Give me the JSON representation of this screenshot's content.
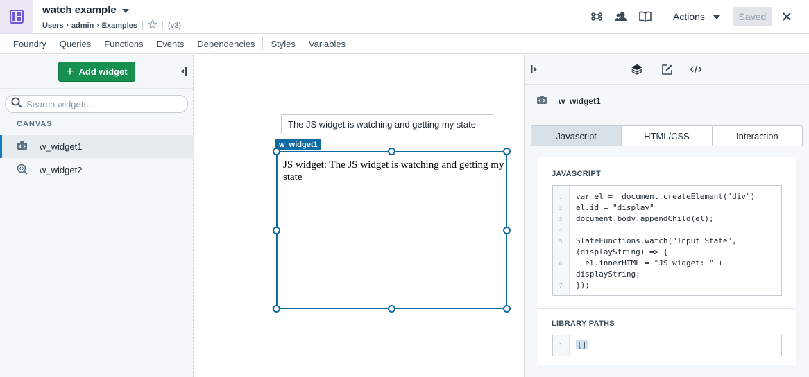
{
  "header": {
    "title": "watch example",
    "breadcrumbs": [
      "Users",
      "admin",
      "Examples"
    ],
    "version": "(v3)",
    "actions_label": "Actions",
    "saved_label": "Saved"
  },
  "menu": {
    "items": [
      "Foundry",
      "Queries",
      "Functions",
      "Events",
      "Dependencies",
      "Styles",
      "Variables"
    ]
  },
  "left": {
    "add_widget_label": "Add widget",
    "search_placeholder": "Search widgets...",
    "canvas_label": "CANVAS",
    "widgets": [
      {
        "name": "w_widget1",
        "selected": true
      },
      {
        "name": "w_widget2",
        "selected": false
      }
    ]
  },
  "canvas": {
    "text_input_value": "The JS widget is watching and getting my state",
    "widget_tag": "w_widget1",
    "widget_output": "JS widget: The JS widget is watching and getting my state"
  },
  "right": {
    "selected_widget": "w_widget1",
    "tabs": [
      {
        "label": "Javascript",
        "active": true
      },
      {
        "label": "HTML/CSS",
        "active": false
      },
      {
        "label": "Interaction",
        "active": false
      }
    ],
    "javascript_label": "JAVASCRIPT",
    "code_lines": [
      {
        "num": "1",
        "text": "var el =  document.createElement(\"div\")"
      },
      {
        "num": "2",
        "text": "el.id = \"display\""
      },
      {
        "num": "3",
        "text": "document.body.appendChild(el);"
      },
      {
        "num": "4",
        "text": ""
      },
      {
        "num": "5",
        "text": "SlateFunctions.watch(\"Input State\","
      },
      {
        "num": "",
        "text": "(displayString) => {"
      },
      {
        "num": "6",
        "text": "  el.innerHTML = \"JS widget: \" +"
      },
      {
        "num": "",
        "text": "displayString;"
      },
      {
        "num": "7",
        "text": "});"
      }
    ],
    "library_paths_label": "LIBRARY PATHS",
    "library_line_num": "1",
    "library_value": "[]"
  },
  "colors": {
    "accent_blue": "#106ba3",
    "add_button_green": "#15904f",
    "app_icon_bg": "#ece6f5",
    "app_icon_fg": "#7157d9"
  },
  "icons": {
    "app": "app-layout-icon",
    "command": "command-icon",
    "users": "users-icon",
    "docs": "book-icon",
    "close": "close-icon",
    "layers": "layers-icon",
    "edit": "edit-icon",
    "code": "code-icon"
  }
}
